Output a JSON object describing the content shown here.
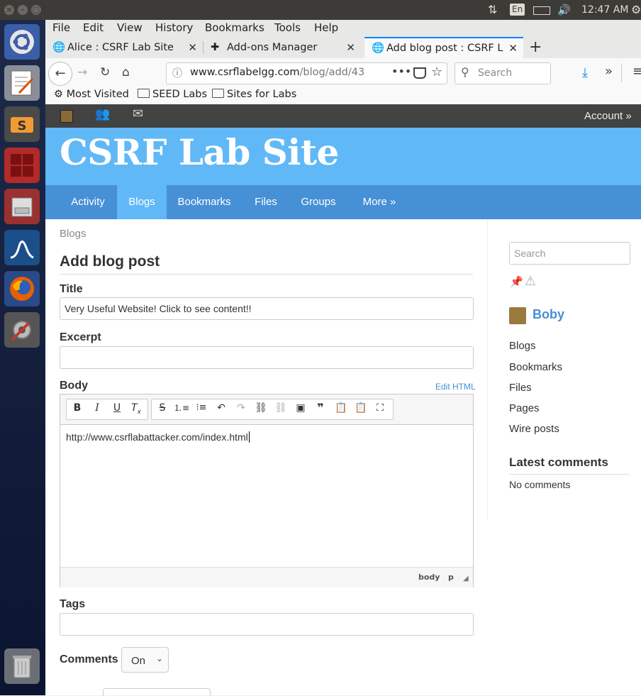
{
  "system": {
    "keyboard_layout": "En",
    "clock": "12:47 AM"
  },
  "browser": {
    "menus": [
      "File",
      "Edit",
      "View",
      "History",
      "Bookmarks",
      "Tools",
      "Help"
    ],
    "tabs": [
      {
        "title": "Alice : CSRF Lab Site",
        "active": false
      },
      {
        "title": "Add-ons Manager",
        "active": false
      },
      {
        "title": "Add blog post : CSRF Lab",
        "active": true
      }
    ],
    "url_domain": "www.csrflabelgg.com",
    "url_path": "/blog/add/43",
    "search_placeholder": "Search",
    "bookmarks": [
      "Most Visited",
      "SEED Labs",
      "Sites for Labs"
    ]
  },
  "site": {
    "account_label": "Account »",
    "title": "CSRF Lab Site",
    "nav": [
      {
        "label": "Activity",
        "selected": false
      },
      {
        "label": "Blogs",
        "selected": true
      },
      {
        "label": "Bookmarks",
        "selected": false
      },
      {
        "label": "Files",
        "selected": false
      },
      {
        "label": "Groups",
        "selected": false
      },
      {
        "label": "More »",
        "selected": false
      }
    ]
  },
  "form": {
    "breadcrumb": "Blogs",
    "heading": "Add blog post",
    "title_label": "Title",
    "title_value": "Very Useful Website! Click to see content!!",
    "excerpt_label": "Excerpt",
    "excerpt_value": "",
    "body_label": "Body",
    "edit_html_link": "Edit HTML",
    "body_text": "http://www.csrflabattacker.com/index.html",
    "status_path": "body   p",
    "tags_label": "Tags",
    "tags_value": "",
    "comments_label": "Comments",
    "comments_value": "On"
  },
  "sidebar": {
    "search_placeholder": "Search",
    "user_name": "Boby",
    "links": [
      "Blogs",
      "Bookmarks",
      "Files",
      "Pages",
      "Wire posts"
    ],
    "latest_comments_heading": "Latest comments",
    "no_comments": "No comments"
  },
  "colors": {
    "header_blue": "#60b8f7",
    "nav_blue": "#4690d6",
    "topbar_dark": "#424242",
    "link_blue": "#4690d6"
  }
}
